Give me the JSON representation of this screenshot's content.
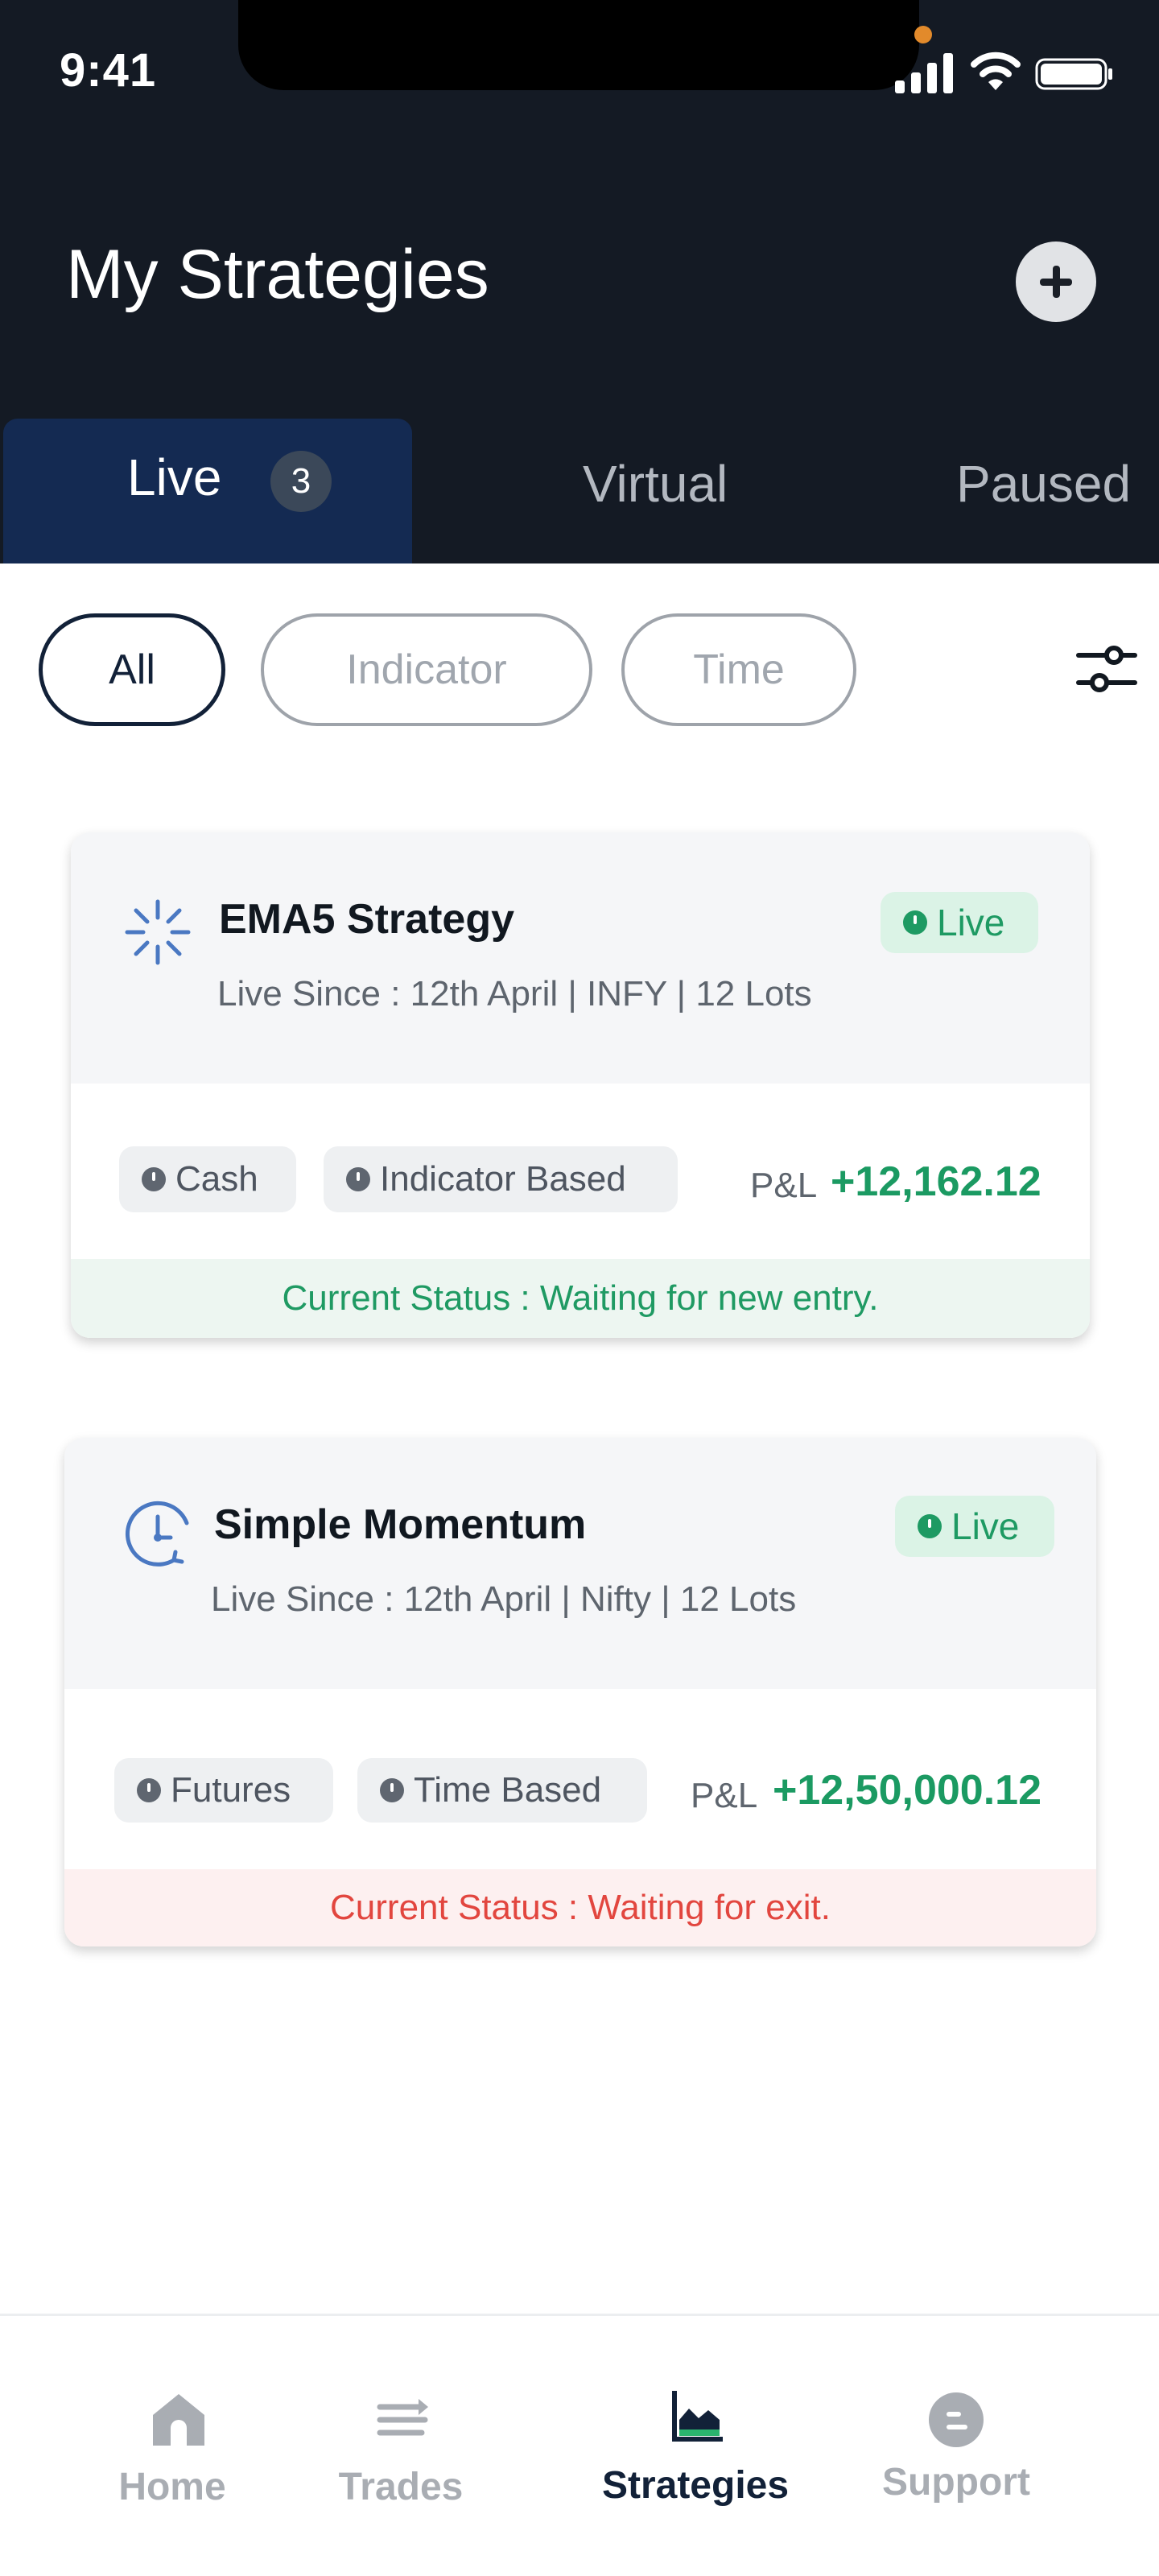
{
  "status_bar": {
    "time": "9:41"
  },
  "header": {
    "title": "My Strategies"
  },
  "tabs": [
    {
      "label": "Live",
      "count": "3"
    },
    {
      "label": "Virtual"
    },
    {
      "label": "Paused"
    }
  ],
  "filters": [
    "All",
    "Indicator",
    "Time"
  ],
  "cards": [
    {
      "name": "EMA5 Strategy",
      "subtitle": "Live Since : 12th April | INFY | 12 Lots",
      "badge": "Live",
      "tags": [
        "Cash",
        "Indicator Based"
      ],
      "pnl_label": "P&L",
      "pnl_value": "+12,162.12",
      "status": "Current Status : Waiting for new entry."
    },
    {
      "name": "Simple Momentum",
      "subtitle": "Live Since : 12th April | Nifty | 12 Lots",
      "badge": "Live",
      "tags": [
        "Futures",
        "Time Based"
      ],
      "pnl_label": "P&L",
      "pnl_value": "+12,50,000.12",
      "status": "Current Status : Waiting for exit."
    }
  ],
  "bottom_nav": [
    {
      "label": "Home",
      "icon": "home-icon"
    },
    {
      "label": "Trades",
      "icon": "trades-icon"
    },
    {
      "label": "Strategies",
      "icon": "strategies-icon",
      "active": true
    },
    {
      "label": "Support",
      "icon": "support-icon"
    }
  ],
  "colors": {
    "header_bg": "#141a24",
    "active_tab": "#142a52",
    "profit_green": "#1b9a62",
    "status_red": "#e2463f"
  }
}
